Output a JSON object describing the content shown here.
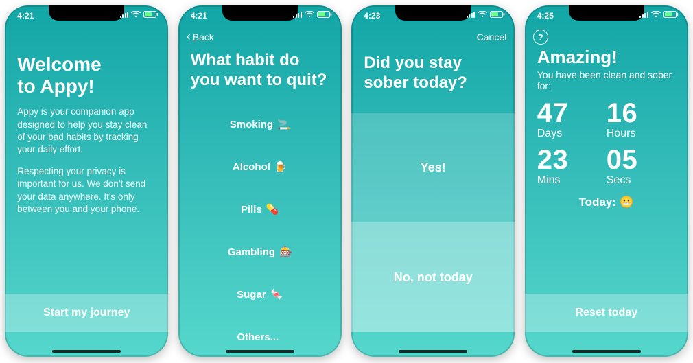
{
  "screens": {
    "welcome": {
      "status_time": "4:21",
      "title_line1": "Welcome",
      "title_line2": "to Appy!",
      "paragraph1": "Appy is your companion app designed to help you stay clean of your bad habits by tracking your daily effort.",
      "paragraph2": "Respecting your privacy is important for us. We don't send your data anywhere. It's only between you and your phone.",
      "start_button": "Start my journey"
    },
    "habits": {
      "status_time": "4:21",
      "nav_back": "Back",
      "title": "What habit do you want to quit?",
      "items": [
        {
          "label": "Smoking",
          "emoji": "🚬"
        },
        {
          "label": "Alcohol",
          "emoji": "🍺"
        },
        {
          "label": "Pills",
          "emoji": "💊"
        },
        {
          "label": "Gambling",
          "emoji": "🎰"
        },
        {
          "label": "Sugar",
          "emoji": "🍬"
        },
        {
          "label": "Others...",
          "emoji": ""
        }
      ]
    },
    "checkin": {
      "status_time": "4:23",
      "nav_cancel": "Cancel",
      "title": "Did you stay sober today?",
      "option_yes": "Yes!",
      "option_no": "No, not today"
    },
    "progress": {
      "status_time": "4:25",
      "heading": "Amazing!",
      "subtitle": "You have been clean and sober for:",
      "counters": {
        "days": {
          "value": "47",
          "unit": "Days"
        },
        "hours": {
          "value": "16",
          "unit": "Hours"
        },
        "mins": {
          "value": "23",
          "unit": "Mins"
        },
        "secs": {
          "value": "05",
          "unit": "Secs"
        }
      },
      "today_label": "Today:",
      "today_emoji": "😬",
      "reset_button": "Reset today"
    }
  }
}
